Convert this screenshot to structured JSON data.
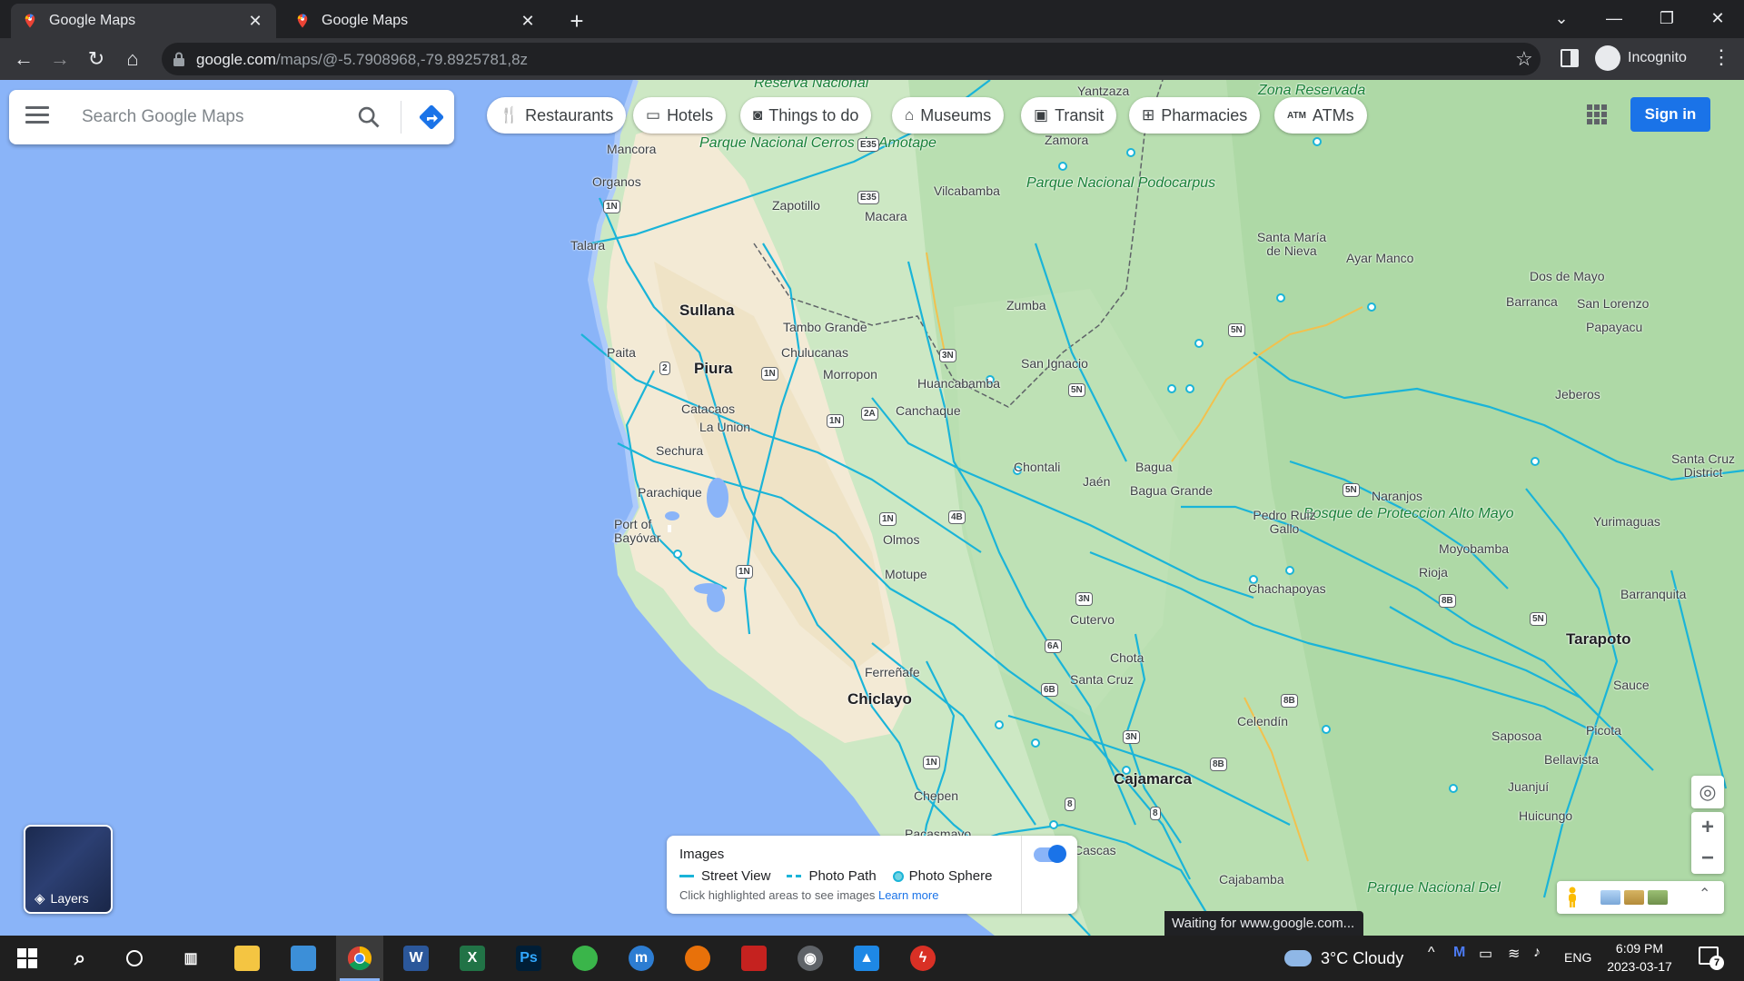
{
  "tabs": [
    {
      "title": "Google Maps",
      "active": true
    },
    {
      "title": "Google Maps",
      "active": false
    }
  ],
  "toolbar": {
    "url_host": "google.com",
    "url_path": "/maps/@-5.7908968,-79.8925781,8z",
    "profile_label": "Incognito"
  },
  "search": {
    "placeholder": "Search Google Maps"
  },
  "chips": [
    {
      "label": "Restaurants",
      "icon": "fork-knife-icon"
    },
    {
      "label": "Hotels",
      "icon": "bed-icon"
    },
    {
      "label": "Things to do",
      "icon": "camera-icon"
    },
    {
      "label": "Museums",
      "icon": "museum-icon"
    },
    {
      "label": "Transit",
      "icon": "bus-icon"
    },
    {
      "label": "Pharmacies",
      "icon": "pharmacy-icon"
    },
    {
      "label": "ATMs",
      "icon": "atm-icon"
    }
  ],
  "signin_label": "Sign in",
  "layers_label": "Layers",
  "images_panel": {
    "title": "Images",
    "legend": [
      "Street View",
      "Photo Path",
      "Photo Sphere"
    ],
    "hint": "Click highlighted areas to see images",
    "link": "Learn more"
  },
  "status_text": "Waiting for www.google.com...",
  "places": {
    "mancora": "Mancora",
    "organos": "Organos",
    "talara": "Talara",
    "sullana": "Sullana",
    "paita": "Paita",
    "piura": "Piura",
    "catacaos": "Catacaos",
    "launion": "La Union",
    "sechura": "Sechura",
    "parachique": "Parachique",
    "portofbayovar": "Port of Bayóvar",
    "zapotillo": "Zapotillo",
    "macara": "Macara",
    "vilcabamba": "Vilcabamba",
    "zamora": "Zamora",
    "yantzaza": "Yantzaza",
    "tambogrande": "Tambo Grande",
    "chulucanas": "Chulucanas",
    "morropon": "Morropon",
    "zumba": "Zumba",
    "huancabamba": "Huancabamba",
    "sanignacio": "San Ignacio",
    "canchaque": "Canchaque",
    "chontali": "Chontali",
    "jaen": "Jaén",
    "bagua": "Bagua",
    "baguagrande": "Bagua Grande",
    "olmos": "Olmos",
    "motupe": "Motupe",
    "ferrenafe": "Ferreñafe",
    "chiclayo": "Chiclayo",
    "chepen": "Chepen",
    "pacasmayo": "Pacasmayo",
    "cutervo": "Cutervo",
    "chota": "Chota",
    "santacruz": "Santa Cruz",
    "celendin": "Celendín",
    "cajamarca": "Cajamarca",
    "cajabamba": "Cajabamba",
    "cascas": "Cascas",
    "chachapoyas": "Chachapoyas",
    "pedroruizgallo": "Pedro Ruiz Gallo",
    "naranjos": "Naranjos",
    "moyobamba": "Moyobamba",
    "rioja": "Rioja",
    "tarapoto": "Tarapoto",
    "sauce": "Sauce",
    "picota": "Picota",
    "saposoa": "Saposoa",
    "bellavista": "Bellavista",
    "juanjui": "Juanjuí",
    "huicungo": "Huicungo",
    "yurimaguas": "Yurimaguas",
    "barranquita": "Barranquita",
    "santamariadenieva": "Santa María de Nieva",
    "ayarmanco": "Ayar Manco",
    "dosdemayo": "Dos de Mayo",
    "barranca": "Barranca",
    "sanlorenzo": "San Lorenzo",
    "papayacu": "Papayacu",
    "jeberos": "Jeberos",
    "santacruzdistrict": "Santa Cruz District",
    "parque_amotape": "Parque Nacional Cerros de Amotape",
    "parque_podocarpus": "Parque Nacional Podocarpus",
    "zona_reservada": "Zona Reservada",
    "bosque_altomayo": "Bosque de Proteccion Alto Mayo",
    "parque_bottom": "Parque Nacional Del",
    "reserva": "Reserva Nacional"
  },
  "taskbar": {
    "weather": "3°C  Cloudy",
    "lang": "ENG",
    "time": "6:09 PM",
    "date": "2023-03-17",
    "notification_count": "7"
  }
}
